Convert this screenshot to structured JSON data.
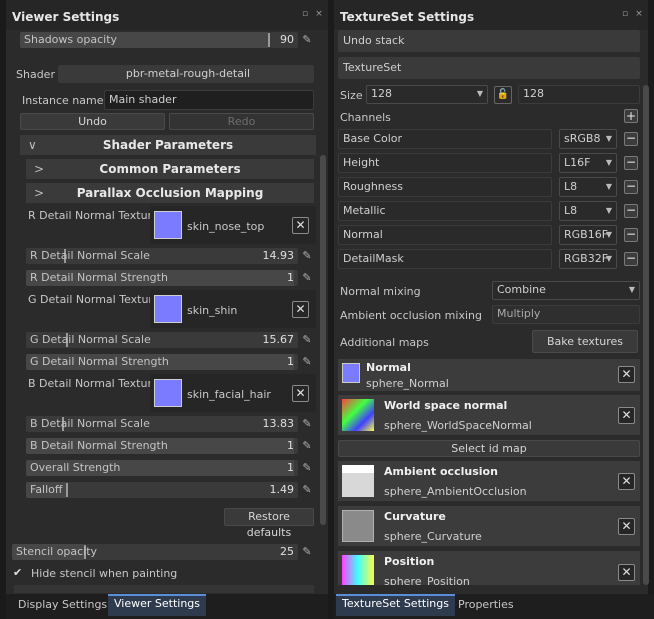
{
  "left_panel": {
    "title": "Viewer Settings",
    "shadows_opacity": {
      "label": "Shadows opacity",
      "value": "90",
      "fraction": 0.9
    },
    "shader": {
      "label": "Shader",
      "value": "pbr-metal-rough-detail"
    },
    "instance_name": {
      "label": "Instance name",
      "value": "Main shader"
    },
    "undo_label": "Undo",
    "redo_label": "Redo",
    "shader_parameters_label": "Shader Parameters",
    "common_parameters_label": "Common Parameters",
    "parallax_label": "Parallax Occlusion Mapping",
    "textures": [
      {
        "label": "R Detail Normal Texture",
        "name": "skin_nose_top"
      },
      {
        "label": "G Detail Normal Texture",
        "name": "skin_shin"
      },
      {
        "label": "B Detail Normal Texture",
        "name": "skin_facial_hair"
      }
    ],
    "r_scale": {
      "label": "R Detail Normal Scale",
      "value": "14.93"
    },
    "r_strength": {
      "label": "R Detail Normal Strength",
      "value": "1"
    },
    "g_scale": {
      "label": "G Detail Normal Scale",
      "value": "15.67"
    },
    "g_strength": {
      "label": "G Detail Normal Strength",
      "value": "1"
    },
    "b_scale": {
      "label": "B Detail Normal Scale",
      "value": "13.83"
    },
    "b_strength": {
      "label": "B Detail Normal Strength",
      "value": "1"
    },
    "overall_strength": {
      "label": "Overall Strength",
      "value": "1"
    },
    "falloff": {
      "label": "Falloff",
      "value": "1.49"
    },
    "restore_defaults_label": "Restore defaults",
    "stencil_opacity": {
      "label": "Stencil opacity",
      "value": "25"
    },
    "hide_stencil_label": "Hide stencil when painting",
    "tabs": [
      "Display Settings",
      "Viewer Settings"
    ]
  },
  "right_panel": {
    "title": "TextureSet Settings",
    "undo_stack_label": "Undo stack",
    "textureset_label": "TextureSet",
    "size_label": "Size",
    "size_value": "128",
    "size_value2": "128",
    "channels_label": "Channels",
    "channels": [
      {
        "name": "Base Color",
        "format": "sRGB8"
      },
      {
        "name": "Height",
        "format": "L16F"
      },
      {
        "name": "Roughness",
        "format": "L8"
      },
      {
        "name": "Metallic",
        "format": "L8"
      },
      {
        "name": "Normal",
        "format": "RGB16F"
      },
      {
        "name": "DetailMask",
        "format": "RGB32F"
      }
    ],
    "normal_mixing": {
      "label": "Normal mixing",
      "value": "Combine"
    },
    "ao_mixing": {
      "label": "Ambient occlusion mixing",
      "value": "Multiply"
    },
    "additional_maps_label": "Additional maps",
    "bake_textures_label": "Bake textures",
    "select_id_map_label": "Select id map",
    "maps": [
      {
        "title": "Normal",
        "file": "sphere_Normal"
      },
      {
        "title": "World space normal",
        "file": "sphere_WorldSpaceNormal"
      },
      {
        "title": "Ambient occlusion",
        "file": "sphere_AmbientOcclusion"
      },
      {
        "title": "Curvature",
        "file": "sphere_Curvature"
      },
      {
        "title": "Position",
        "file": "sphere_Position"
      }
    ],
    "tabs": [
      "TextureSet Settings",
      "Properties"
    ]
  },
  "colors": {
    "accent": "#5a8fd8",
    "swatch": "#7b7bff",
    "panel": "#2b2b2b"
  }
}
